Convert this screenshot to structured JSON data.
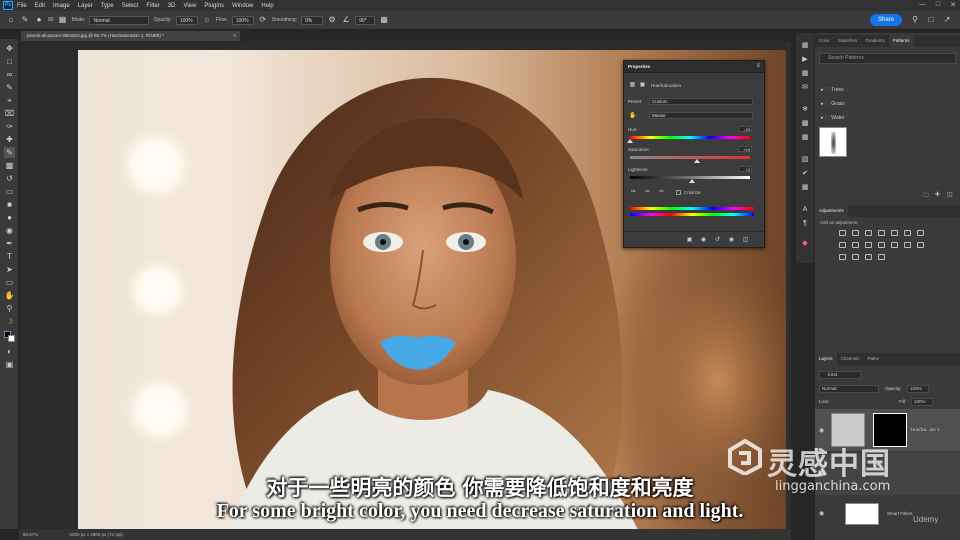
{
  "menubar": {
    "logo": "Ps",
    "items": [
      "File",
      "Edit",
      "Image",
      "Layer",
      "Type",
      "Select",
      "Filter",
      "3D",
      "View",
      "Plugins",
      "Window",
      "Help"
    ]
  },
  "options": {
    "brush_size": "80",
    "mode_label": "Mode:",
    "mode_value": "Normal",
    "opacity_label": "Opacity:",
    "opacity_value": "100%",
    "flow_label": "Flow:",
    "flow_value": "100%",
    "smoothing_label": "Smoothing:",
    "smoothing_value": "0%",
    "angle_value": "90°",
    "share_label": "Share"
  },
  "document": {
    "tab_title": "pexels-ali-pazani-3861814.jpg @ 66.7% (Hue/Saturation 1, RGB/8) *",
    "zoom": "66.67%",
    "doc_size": "2000 px x 2000 px (72 ppi)"
  },
  "properties": {
    "title": "Properties",
    "layer_type": "Hue/Saturation",
    "preset_label": "Preset:",
    "preset_value": "Custom",
    "channel_value": "Master",
    "hue_label": "Hue:",
    "hue_value": "-93",
    "saturation_label": "Saturation:",
    "saturation_value": "+16",
    "lightness_label": "Lightness:",
    "lightness_value": "+3",
    "colorize_label": "Colorize",
    "hue_fraction": 0.0,
    "saturation_fraction": 0.56,
    "lightness_fraction": 0.52
  },
  "swatch_panel": {
    "tabs": [
      "Color",
      "Swatches",
      "Gradients",
      "Patterns"
    ],
    "active_tab": "Patterns",
    "search_placeholder": "Search Patterns",
    "folders": [
      "Trees",
      "Grass",
      "Water"
    ]
  },
  "adjustments": {
    "title": "Adjustments",
    "add_label": "Add an adjustment"
  },
  "layers": {
    "tabs": [
      "Layers",
      "Channels",
      "Paths"
    ],
    "active_tab": "Layers",
    "kind_value": "Kind",
    "blend_value": "Normal",
    "opacity_label": "Opacity:",
    "opacity_value": "100%",
    "lock_label": "Lock:",
    "fill_label": "Fill:",
    "fill_value": "100%",
    "adj_layer_name": "Hue/Sa...ion 1",
    "smart_filters_label": "Smart Filters"
  },
  "subtitles": {
    "chinese": "对于一些明亮的颜色 你需要降低饱和度和亮度",
    "english": "For some bright color, you need decrease saturation and light."
  },
  "watermark": {
    "brand": "灵感中国",
    "url": "lingganchina.com",
    "udemy": "Udemy"
  },
  "colors": {
    "accent": "#1473e6",
    "lips": "#46a9e6",
    "panel": "#3a3a3a"
  }
}
